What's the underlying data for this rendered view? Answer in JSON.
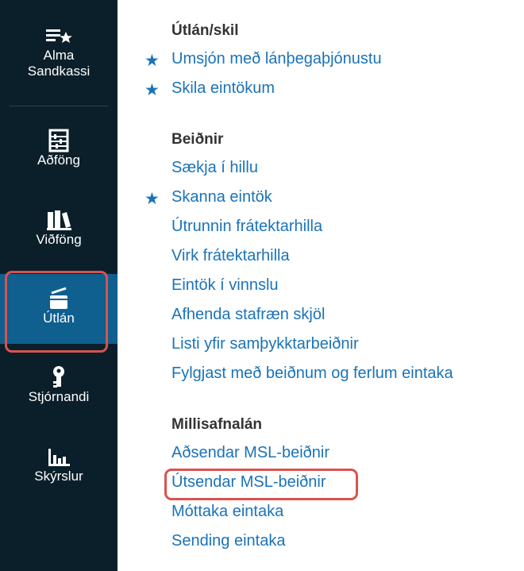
{
  "sidebar": {
    "items": [
      {
        "label": "Alma\nSandkassi",
        "icon": "favorites-star-list-icon"
      },
      {
        "label": "Aðföng",
        "icon": "abacus-icon"
      },
      {
        "label": "Viðföng",
        "icon": "books-icon"
      },
      {
        "label": "Útlán",
        "icon": "fulfillment-box-icon",
        "active": true
      },
      {
        "label": "Stjórnandi",
        "icon": "admin-key-icon"
      },
      {
        "label": "Skýrslur",
        "icon": "bar-chart-icon"
      }
    ]
  },
  "menu": {
    "sections": [
      {
        "title": "Útlán/skil",
        "links": [
          {
            "label": "Umsjón með lánþegaþjónustu",
            "starred": true
          },
          {
            "label": "Skila eintökum",
            "starred": true
          }
        ]
      },
      {
        "title": "Beiðnir",
        "links": [
          {
            "label": "Sækja í hillu",
            "starred": false
          },
          {
            "label": "Skanna eintök",
            "starred": true
          },
          {
            "label": "Útrunnin frátektarhilla",
            "starred": false
          },
          {
            "label": "Virk frátektarhilla",
            "starred": false
          },
          {
            "label": "Eintök í vinnslu",
            "starred": false
          },
          {
            "label": "Afhenda stafræn skjöl",
            "starred": false
          },
          {
            "label": "Listi yfir samþykktarbeiðnir",
            "starred": false
          },
          {
            "label": "Fylgjast með beiðnum og ferlum eintaka",
            "starred": false
          }
        ]
      },
      {
        "title": "Millisafnalán",
        "links": [
          {
            "label": "Aðsendar MSL-beiðnir",
            "starred": false
          },
          {
            "label": "Útsendar MSL-beiðnir",
            "starred": false,
            "highlighted": true
          },
          {
            "label": "Móttaka eintaka",
            "starred": false
          },
          {
            "label": "Sending eintaka",
            "starred": false
          }
        ]
      }
    ]
  },
  "colors": {
    "sidebar_bg": "#0b1f2a",
    "active_bg": "#0f5f8f",
    "link": "#1a73b8",
    "highlight_border": "#d9534f"
  }
}
